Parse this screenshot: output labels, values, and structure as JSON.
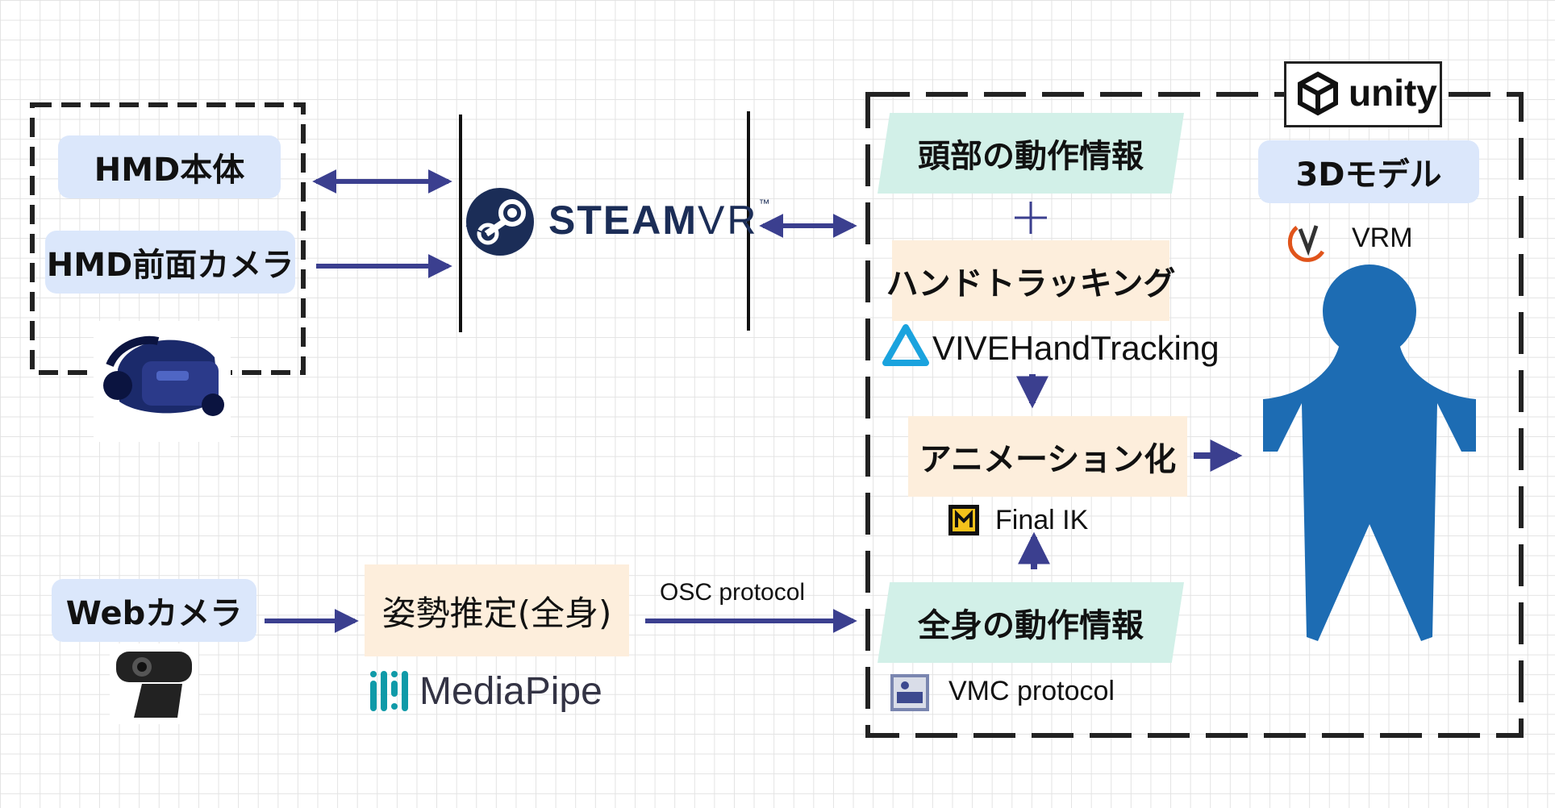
{
  "hmd_group": {
    "hmd_body": "HMD本体",
    "hmd_front_camera": "HMD前面カメラ"
  },
  "steamvr": {
    "logo_word": "STEAM",
    "logo_vr": "VR",
    "logo_tm": "™"
  },
  "webcam": {
    "label": "Webカメラ"
  },
  "pose": {
    "label": "姿勢推定(全身)",
    "tool": "MediaPipe"
  },
  "osc": {
    "label": "OSC protocol"
  },
  "unity_group": {
    "logo_text": "unity",
    "head_motion": "頭部の動作情報",
    "plus": "+",
    "hand_tracking": "ハンドトラッキング",
    "vive_hand_tracking": "VIVEHandTracking",
    "animation": "アニメーション化",
    "final_ik": "Final IK",
    "body_motion": "全身の動作情報",
    "vmc_protocol": "VMC protocol",
    "model_3d": "3Dモデル",
    "vrm": "VRM"
  },
  "colors": {
    "arrow": "#3b3f8f",
    "blue_box": "#dbe7fb",
    "peach_box": "#fdeedc",
    "mint_box": "#d2f0e8",
    "figure": "#1d6cb3",
    "steam_blue": "#1b2d57",
    "vive_blue": "#1aa3de",
    "mediapipe_teal": "#0f9aa8"
  },
  "icons": [
    "vr-headset-icon",
    "steam-logo-icon",
    "webcam-icon",
    "mediapipe-logo-icon",
    "unity-logo-icon",
    "vive-logo-icon",
    "final-ik-icon",
    "vmc-logo-icon",
    "vrm-logo-icon",
    "person-figure-icon"
  ]
}
